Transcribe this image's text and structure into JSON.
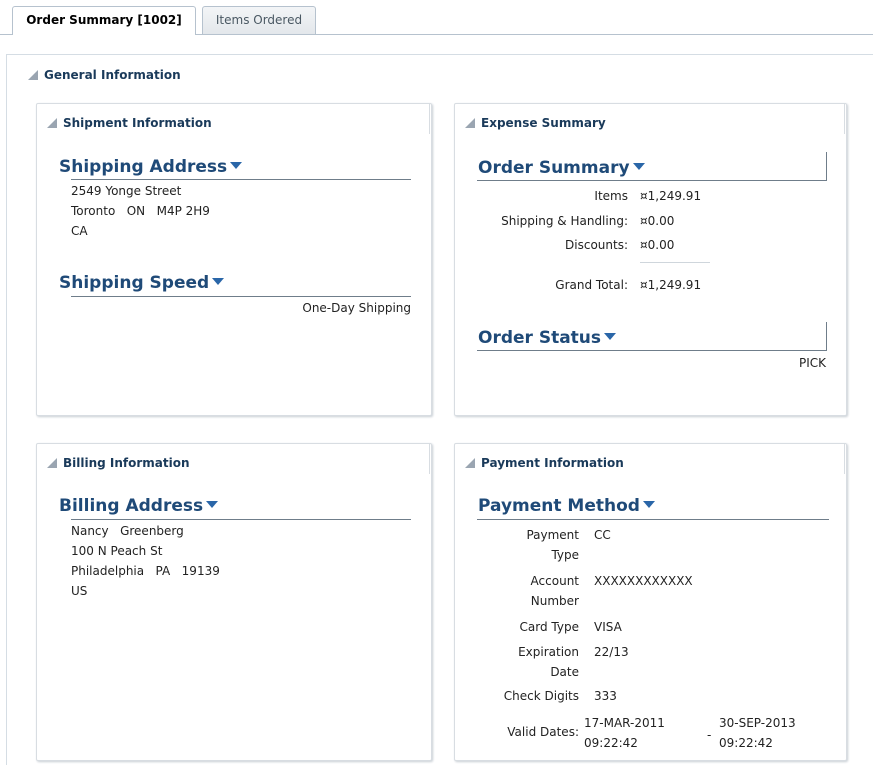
{
  "tabs": [
    {
      "label": "Order Summary [1002]"
    },
    {
      "label": "Items Ordered"
    }
  ],
  "section": {
    "title": "General Information"
  },
  "shipment": {
    "title": "Shipment Information",
    "address_heading": "Shipping Address",
    "address_lines": [
      "2549 Yonge Street",
      "Toronto   ON   M4P 2H9",
      "CA"
    ],
    "speed_heading": "Shipping Speed",
    "speed_value": "One-Day Shipping"
  },
  "expense": {
    "title": "Expense Summary",
    "order_summary_heading": "Order Summary",
    "rows": [
      {
        "label": "Items",
        "value": "¤1,249.91"
      },
      {
        "label": "Shipping & Handling:",
        "value": "¤0.00"
      },
      {
        "label": "Discounts:",
        "value": "¤0.00"
      },
      {
        "label": "Grand Total:",
        "value": "¤1,249.91"
      }
    ],
    "status_heading": "Order Status",
    "status_value": "PICK"
  },
  "billing": {
    "title": "Billing Information",
    "address_heading": "Billing Address",
    "address_lines": [
      "Nancy   Greenberg",
      "100 N Peach St",
      "Philadelphia   PA   19139",
      "US"
    ]
  },
  "payment": {
    "title": "Payment Information",
    "method_heading": "Payment Method",
    "payment_type_label": [
      "Payment",
      "Type"
    ],
    "payment_type_value": "CC",
    "account_number_label": [
      "Account",
      "Number"
    ],
    "account_number_value": "XXXXXXXXXXXX",
    "card_type_label": "Card Type",
    "card_type_value": "VISA",
    "expiration_label": [
      "Expiration",
      "Date"
    ],
    "expiration_value": "22/13",
    "check_digits_label": "Check Digits",
    "check_digits_value": "333",
    "valid_dates_label": "Valid Dates:",
    "valid_from": [
      "17-MAR-2011",
      "09:22:42"
    ],
    "valid_separator": "-",
    "valid_to": [
      "30-SEP-2013",
      "09:22:42"
    ]
  },
  "colors": {
    "heading": "#1f4a78",
    "caret": "#2a66a8",
    "panel_border": "#d8dde2"
  }
}
